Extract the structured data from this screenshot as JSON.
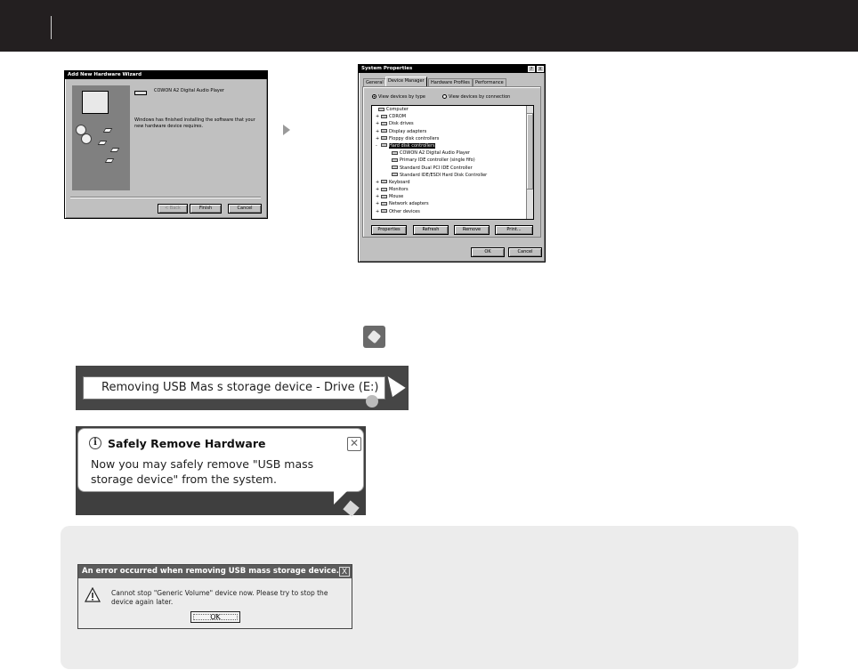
{
  "wizard": {
    "title": "Add New Hardware Wizard",
    "device_name": "COWON A2 Digital Audio Player",
    "message": "Windows has finished installing the software that your new hardware device requires.",
    "back_label": "< Back",
    "finish_label": "Finish",
    "cancel_label": "Cancel"
  },
  "system_properties": {
    "title": "System Properties",
    "help_label": "?",
    "close_label": "X",
    "tabs": [
      "General",
      "Device Manager",
      "Hardware Profiles",
      "Performance"
    ],
    "active_tab": "Device Manager",
    "radio_by_type": "View devices by type",
    "radio_by_connection": "View devices by connection",
    "tree": [
      {
        "expander": "",
        "label": "Computer"
      },
      {
        "expander": "+",
        "label": "CDROM"
      },
      {
        "expander": "+",
        "label": "Disk drives"
      },
      {
        "expander": "+",
        "label": "Display adapters"
      },
      {
        "expander": "+",
        "label": "Floppy disk controllers"
      },
      {
        "expander": "-",
        "label": "Hard disk controllers",
        "selected": true
      },
      {
        "expander": "",
        "label": "COWON A2 Digital Audio Player"
      },
      {
        "expander": "",
        "label": "Primary IDE controller (single fifo)"
      },
      {
        "expander": "",
        "label": "Standard Dual PCI IDE Controller"
      },
      {
        "expander": "",
        "label": "Standard IDE/ESDI Hard Disk Controller"
      },
      {
        "expander": "+",
        "label": "Keyboard"
      },
      {
        "expander": "+",
        "label": "Monitors"
      },
      {
        "expander": "+",
        "label": "Mouse"
      },
      {
        "expander": "+",
        "label": "Network adapters"
      },
      {
        "expander": "+",
        "label": "Other devices"
      }
    ],
    "properties_label": "Properties",
    "refresh_label": "Refresh",
    "remove_label": "Remove",
    "print_label": "Print...",
    "ok_label": "OK",
    "cancel_label": "Cancel"
  },
  "removing_tooltip": {
    "text": "Removing USB Mas s storage device - Drive (E:)"
  },
  "safely_remove": {
    "title": "Safely Remove Hardware",
    "message": "Now you may safely remove \"USB mass storage device\" from the system."
  },
  "error_dialog": {
    "title": "An error occurred when removing USB mass storage device.",
    "close_label": "X",
    "message": "Cannot stop \"Generic Volume\" device now. Please try to stop the device again later.",
    "ok_label": "OK"
  }
}
